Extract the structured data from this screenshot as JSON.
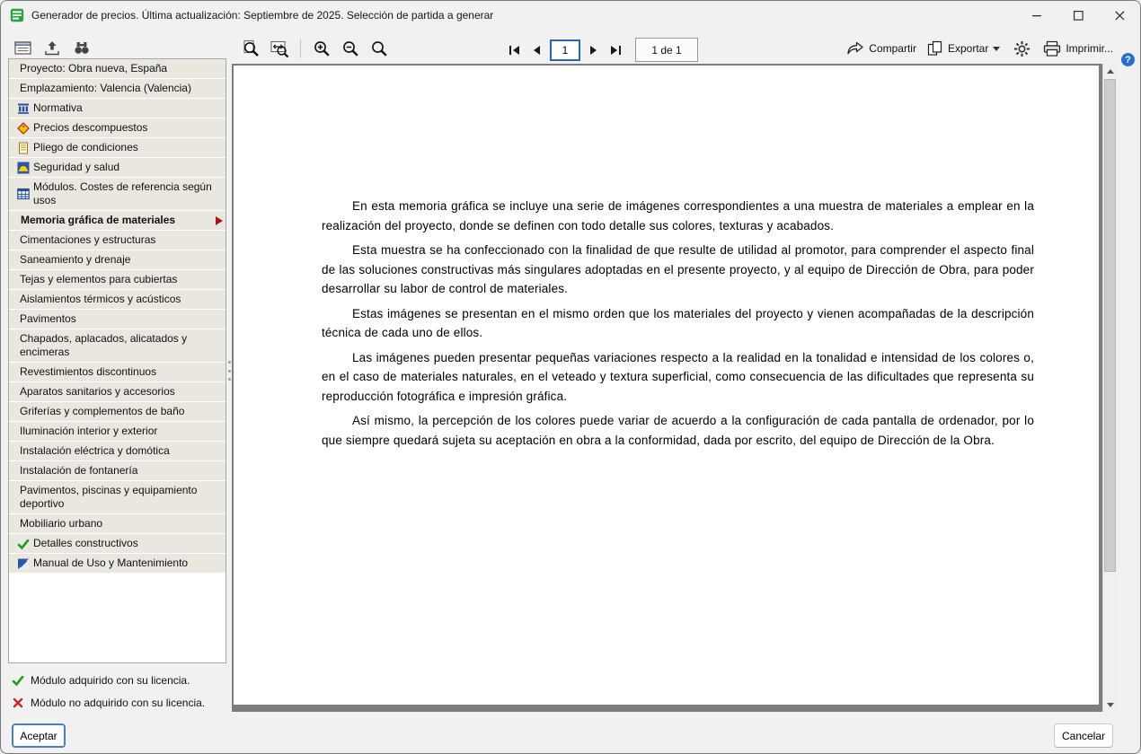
{
  "window": {
    "title": "Generador de precios. Última actualización: Septiembre de 2025. Selección de partida a generar"
  },
  "toolbar": {
    "page_input_value": "1",
    "page_indicator": "1 de 1",
    "share_label": "Compartir",
    "export_label": "Exportar",
    "print_label": "Imprimir...",
    "help_glyph": "?"
  },
  "sidebar": {
    "items": [
      {
        "label": "Proyecto: Obra nueva, España"
      },
      {
        "label": "Emplazamiento: Valencia (Valencia)"
      },
      {
        "label": "Normativa",
        "icon": "normativa"
      },
      {
        "label": "Precios descompuestos",
        "icon": "precios"
      },
      {
        "label": "Pliego de condiciones",
        "icon": "pliego"
      },
      {
        "label": "Seguridad y salud",
        "icon": "seguridad"
      },
      {
        "label": "Módulos. Costes de referencia según usos",
        "icon": "modulos"
      },
      {
        "label": "Memoria gráfica de materiales",
        "bold": true,
        "selected": true
      },
      {
        "label": "Cimentaciones y estructuras"
      },
      {
        "label": "Saneamiento y drenaje"
      },
      {
        "label": "Tejas y elementos para cubiertas"
      },
      {
        "label": "Aislamientos térmicos y acústicos"
      },
      {
        "label": "Pavimentos"
      },
      {
        "label": "Chapados, aplacados, alicatados y encimeras"
      },
      {
        "label": "Revestimientos discontinuos"
      },
      {
        "label": "Aparatos sanitarios y accesorios"
      },
      {
        "label": "Griferías y complementos de baño"
      },
      {
        "label": "Iluminación interior y exterior"
      },
      {
        "label": "Instalación eléctrica y domótica"
      },
      {
        "label": "Instalación de fontanería"
      },
      {
        "label": "Pavimentos, piscinas y equipamiento deportivo"
      },
      {
        "label": "Mobiliario urbano"
      },
      {
        "label": "Detalles constructivos",
        "icon": "check"
      },
      {
        "label": "Manual de Uso y Mantenimiento",
        "icon": "manual"
      }
    ],
    "legend": [
      {
        "icon": "check",
        "label": "Módulo adquirido con su licencia."
      },
      {
        "icon": "cross",
        "label": "Módulo no adquirido con su licencia."
      }
    ]
  },
  "document": {
    "paragraphs": [
      "En esta memoria gráfica se incluye una serie de imágenes correspondientes a una muestra de materiales a emplear en la realización del proyecto, donde se definen con todo detalle sus colores, texturas y acabados.",
      "Esta muestra se ha confeccionado con la finalidad de que resulte de utilidad al promotor, para comprender el aspecto final de las soluciones constructivas más singulares adoptadas en el presente proyecto, y al equipo de Dirección de Obra, para poder desarrollar su labor de control de materiales.",
      "Estas imágenes se presentan en el mismo orden que los materiales del proyecto y vienen acompañadas de la descripción técnica de cada uno de ellos.",
      "Las imágenes pueden presentar pequeñas variaciones respecto a la realidad en la tonalidad e intensidad de los colores o, en el caso de materiales naturales, en el veteado y textura superficial, como consecuencia de las dificultades que representa su reproducción fotográfica e impresión gráfica.",
      "Así mismo, la percepción de los colores puede variar de acuerdo a la configuración de cada pantalla de ordenador, por lo que siempre quedará sujeta su aceptación en obra a la conformidad, dada por escrito, del equipo de Dirección de la Obra."
    ]
  },
  "footer": {
    "accept_label": "Aceptar",
    "cancel_label": "Cancelar"
  }
}
